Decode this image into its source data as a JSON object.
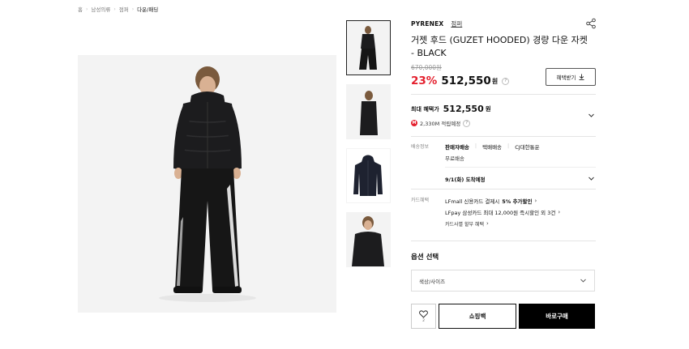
{
  "breadcrumb": {
    "items": [
      "홈",
      "남성의류",
      "점퍼",
      "다운/패딩"
    ]
  },
  "product": {
    "brand": "PYRENEX",
    "category": "점퍼",
    "title": "거젯 후드 (GUZET HOODED) 경량 다운 자켓 - BLACK",
    "original_price": "670,000원",
    "discount": "23%",
    "sale_price": "512,550",
    "currency": "원",
    "benefit_button": "혜택받기"
  },
  "max_benefit": {
    "label": "최대 혜택가",
    "price": "512,550",
    "currency": "원",
    "points": "2,330M 적립예정",
    "point_icon_label": "M"
  },
  "shipping": {
    "label": "배송정보",
    "options": [
      "판매자배송",
      "택배배송",
      "CJ대한통운"
    ],
    "free": "무료배송",
    "arrival": "9/1(화) 도착예정"
  },
  "card": {
    "label": "카드혜택",
    "line1_prefix": "LFmall 신용카드 결제시",
    "line1_highlight": "5% 추가할인",
    "line2": "LFpay 삼성카드 최대 12,000원 즉시할인 외 3건",
    "line3": "카드사별 할부 혜택"
  },
  "options": {
    "title": "옵션 선택",
    "select_placeholder": "색상/사이즈"
  },
  "actions": {
    "wish_count": "2",
    "bag_label": "쇼핑백",
    "buy_label": "바로구매"
  },
  "colors": {
    "discount_red": "#e4202e",
    "jacket_black": "#1c1c1e",
    "pants_black": "#161616",
    "background_gray": "#f3f3f3"
  }
}
